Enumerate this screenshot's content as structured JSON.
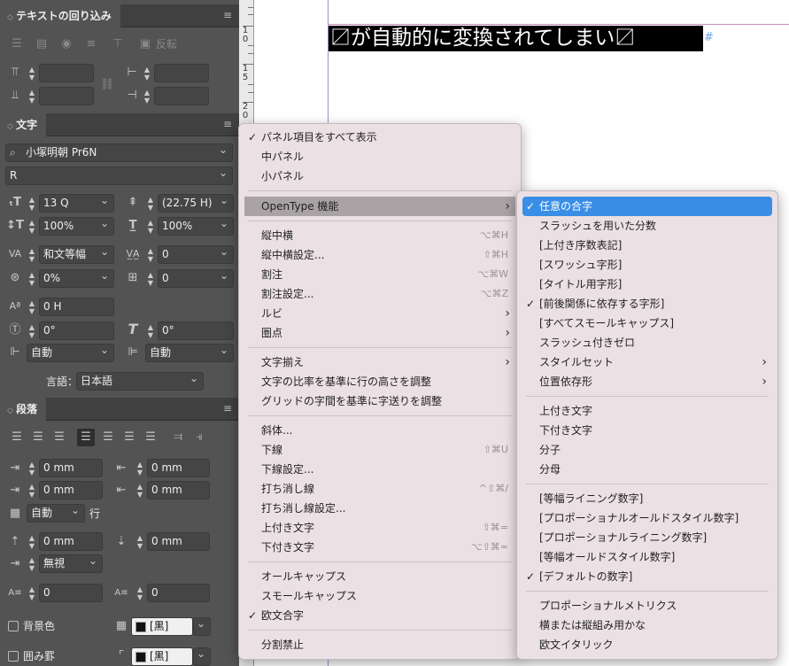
{
  "panel_wrap": {
    "title": "テキストの回り込み",
    "buttons": [
      "反転"
    ]
  },
  "panel_char": {
    "title": "文字",
    "font": "小塚明朝 Pr6N",
    "style": "R",
    "size": "13 Q",
    "leading": "(22.75 H)",
    "vscale": "100%",
    "hscale": "100%",
    "kerning": "和文等幅",
    "tracking": "0",
    "tsume": "0%",
    "grid": "0",
    "baseline": "0 H",
    "rotate": "0°",
    "skew": "0°",
    "aki_before": "自動",
    "aki_after": "自動",
    "lang_label": "言語：",
    "lang": "日本語"
  },
  "panel_para": {
    "title": "段落",
    "left_indent": "0 mm",
    "right_indent": "0 mm",
    "first_indent": "0 mm",
    "last_indent": "0 mm",
    "drop": "自動",
    "drop_unit": "行",
    "space_before": "0 mm",
    "space_after": "0 mm",
    "align_grid": "無視",
    "drop_lines": "0",
    "drop_chars": "0",
    "shading_label": "背景色",
    "shading_swatch": "[黒]",
    "border_label": "囲み罫",
    "border_swatch": "[黒]"
  },
  "ruler": {
    "numbers": [
      "1",
      "0",
      "1",
      "5",
      "2",
      "0"
    ]
  },
  "canvas": {
    "text": "〼が自動的に変換されてしまい〼",
    "end_mark": "#"
  },
  "menu": {
    "items": [
      {
        "label": "パネル項目をすべて表示",
        "check": "✓",
        "shortcut": "",
        "arrow": ""
      },
      {
        "label": "中パネル",
        "check": "",
        "shortcut": "",
        "arrow": ""
      },
      {
        "label": "小パネル",
        "check": "",
        "shortcut": "",
        "arrow": ""
      },
      {
        "label": "OpenType 機能",
        "check": "",
        "shortcut": "",
        "arrow": "›"
      },
      {
        "label": "縦中横",
        "check": "",
        "shortcut": "⌥⌘H",
        "arrow": ""
      },
      {
        "label": "縦中横設定...",
        "check": "",
        "shortcut": "⇧⌘H",
        "arrow": ""
      },
      {
        "label": "割注",
        "check": "",
        "shortcut": "⌥⌘W",
        "arrow": ""
      },
      {
        "label": "割注設定...",
        "check": "",
        "shortcut": "⌥⌘Z",
        "arrow": ""
      },
      {
        "label": "ルビ",
        "check": "",
        "shortcut": "",
        "arrow": "›"
      },
      {
        "label": "圏点",
        "check": "",
        "shortcut": "",
        "arrow": "›"
      },
      {
        "label": "文字揃え",
        "check": "",
        "shortcut": "",
        "arrow": "›"
      },
      {
        "label": "文字の比率を基準に行の高さを調整",
        "check": "",
        "shortcut": "",
        "arrow": ""
      },
      {
        "label": "グリッドの字間を基準に字送りを調整",
        "check": "",
        "shortcut": "",
        "arrow": ""
      },
      {
        "label": "斜体...",
        "check": "",
        "shortcut": "",
        "arrow": ""
      },
      {
        "label": "下線",
        "check": "",
        "shortcut": "⇧⌘U",
        "arrow": ""
      },
      {
        "label": "下線設定...",
        "check": "",
        "shortcut": "",
        "arrow": ""
      },
      {
        "label": "打ち消し線",
        "check": "",
        "shortcut": "^⇧⌘/",
        "arrow": ""
      },
      {
        "label": "打ち消し線設定...",
        "check": "",
        "shortcut": "",
        "arrow": ""
      },
      {
        "label": "上付き文字",
        "check": "",
        "shortcut": "⇧⌘=",
        "arrow": ""
      },
      {
        "label": "下付き文字",
        "check": "",
        "shortcut": "⌥⇧⌘=",
        "arrow": ""
      },
      {
        "label": "オールキャップス",
        "check": "",
        "shortcut": "",
        "arrow": ""
      },
      {
        "label": "スモールキャップス",
        "check": "",
        "shortcut": "",
        "arrow": ""
      },
      {
        "label": "欧文合字",
        "check": "✓",
        "shortcut": "",
        "arrow": ""
      },
      {
        "label": "分割禁止",
        "check": "",
        "shortcut": "",
        "arrow": ""
      }
    ]
  },
  "submenu": {
    "items": [
      {
        "label": "任意の合字",
        "check": "✓",
        "arrow": ""
      },
      {
        "label": "スラッシュを用いた分数",
        "check": "",
        "arrow": ""
      },
      {
        "label": "[上付き序数表記]",
        "check": "",
        "arrow": ""
      },
      {
        "label": "[スワッシュ字形]",
        "check": "",
        "arrow": ""
      },
      {
        "label": "[タイトル用字形]",
        "check": "",
        "arrow": ""
      },
      {
        "label": "[前後関係に依存する字形]",
        "check": "✓",
        "arrow": ""
      },
      {
        "label": "[すべてスモールキャップス]",
        "check": "",
        "arrow": ""
      },
      {
        "label": "スラッシュ付きゼロ",
        "check": "",
        "arrow": ""
      },
      {
        "label": "スタイルセット",
        "check": "",
        "arrow": "›"
      },
      {
        "label": "位置依存形",
        "check": "",
        "arrow": "›"
      },
      {
        "label": "上付き文字",
        "check": "",
        "arrow": ""
      },
      {
        "label": "下付き文字",
        "check": "",
        "arrow": ""
      },
      {
        "label": "分子",
        "check": "",
        "arrow": ""
      },
      {
        "label": "分母",
        "check": "",
        "arrow": ""
      },
      {
        "label": "[等幅ライニング数字]",
        "check": "",
        "arrow": ""
      },
      {
        "label": "[プロポーショナルオールドスタイル数字]",
        "check": "",
        "arrow": ""
      },
      {
        "label": "[プロポーショナルライニング数字]",
        "check": "",
        "arrow": ""
      },
      {
        "label": "[等幅オールドスタイル数字]",
        "check": "",
        "arrow": ""
      },
      {
        "label": "[デフォルトの数字]",
        "check": "✓",
        "arrow": ""
      },
      {
        "label": "プロポーショナルメトリクス",
        "check": "",
        "arrow": ""
      },
      {
        "label": "横または縦組み用かな",
        "check": "",
        "arrow": ""
      },
      {
        "label": "欧文イタリック",
        "check": "",
        "arrow": ""
      }
    ]
  }
}
